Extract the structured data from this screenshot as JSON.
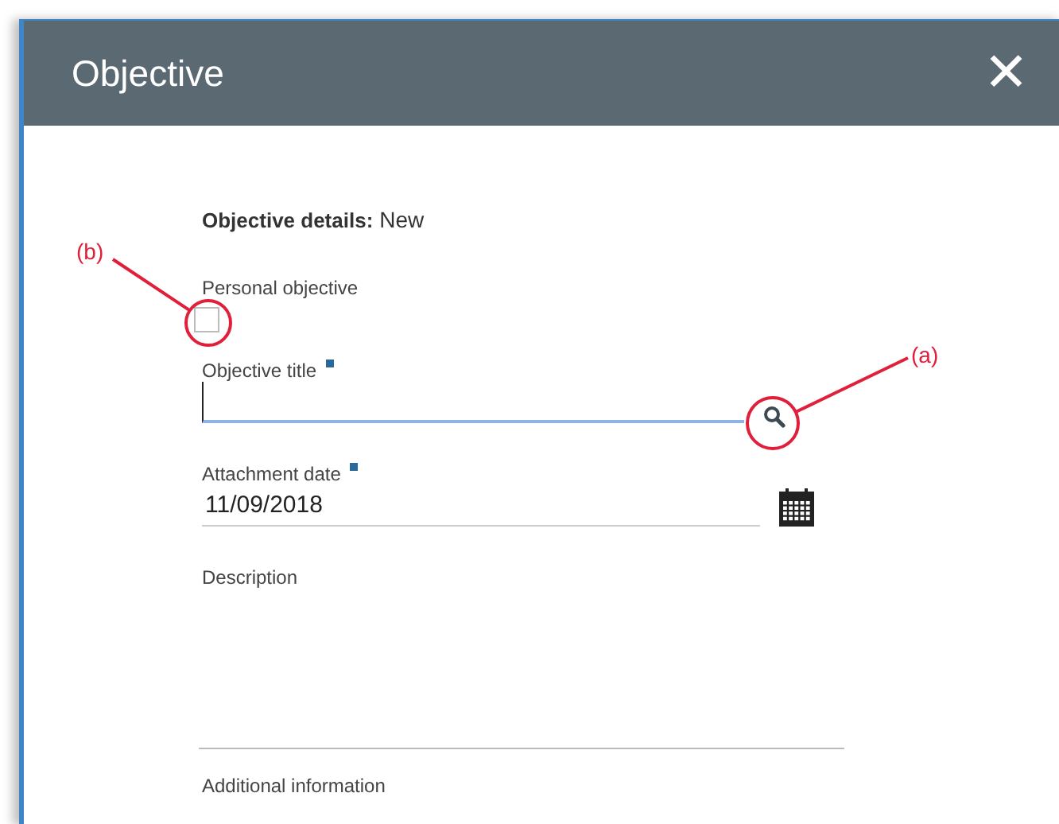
{
  "window": {
    "title": "Objective",
    "close_icon": "✕"
  },
  "heading": {
    "label": "Objective details:",
    "value": "New"
  },
  "fields": [
    {
      "kind": "checkbox",
      "label": "Personal objective",
      "required": false,
      "checked": false
    },
    {
      "kind": "lookup",
      "label": "Objective title",
      "required": true,
      "focused": true
    },
    {
      "kind": "date",
      "label": "Attachment date",
      "required": true,
      "value": "11/09/2018"
    },
    {
      "kind": "textarea",
      "label": "Description",
      "required": false
    },
    {
      "kind": "text",
      "label": "Additional information",
      "required": false
    }
  ],
  "annotations": [
    {
      "label": "(b)"
    },
    {
      "label": "(a)"
    }
  ]
}
